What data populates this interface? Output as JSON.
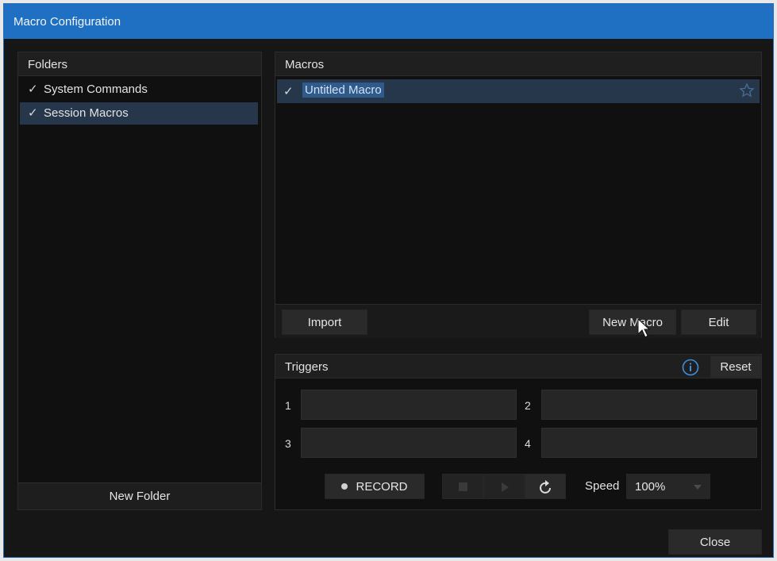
{
  "window": {
    "title": "Macro Configuration"
  },
  "folders": {
    "header": "Folders",
    "items": [
      {
        "check": "✓",
        "label": "System Commands",
        "selected": false
      },
      {
        "check": "✓",
        "label": "Session Macros",
        "selected": true
      }
    ],
    "new_folder_label": "New Folder"
  },
  "macros": {
    "header": "Macros",
    "items": [
      {
        "check": "✓",
        "label": "Untitled Macro",
        "selected": true,
        "favorite_icon": "star-outline-icon"
      }
    ],
    "import_label": "Import",
    "new_macro_label": "New Macro",
    "edit_label": "Edit"
  },
  "triggers": {
    "header": "Triggers",
    "info_icon": "info-circle-icon",
    "reset_label": "Reset",
    "slots": [
      {
        "number": "1",
        "value": ""
      },
      {
        "number": "2",
        "value": ""
      },
      {
        "number": "3",
        "value": ""
      },
      {
        "number": "4",
        "value": ""
      }
    ],
    "record_label": "RECORD",
    "stop_icon": "stop-icon",
    "play_icon": "play-icon",
    "loop_icon": "loop-icon",
    "speed_label": "Speed",
    "speed_value": "100%"
  },
  "footer": {
    "close_label": "Close"
  },
  "colors": {
    "titlebar": "#1f6fc2",
    "selection": "#26374c",
    "accent": "#3d8fdf"
  }
}
